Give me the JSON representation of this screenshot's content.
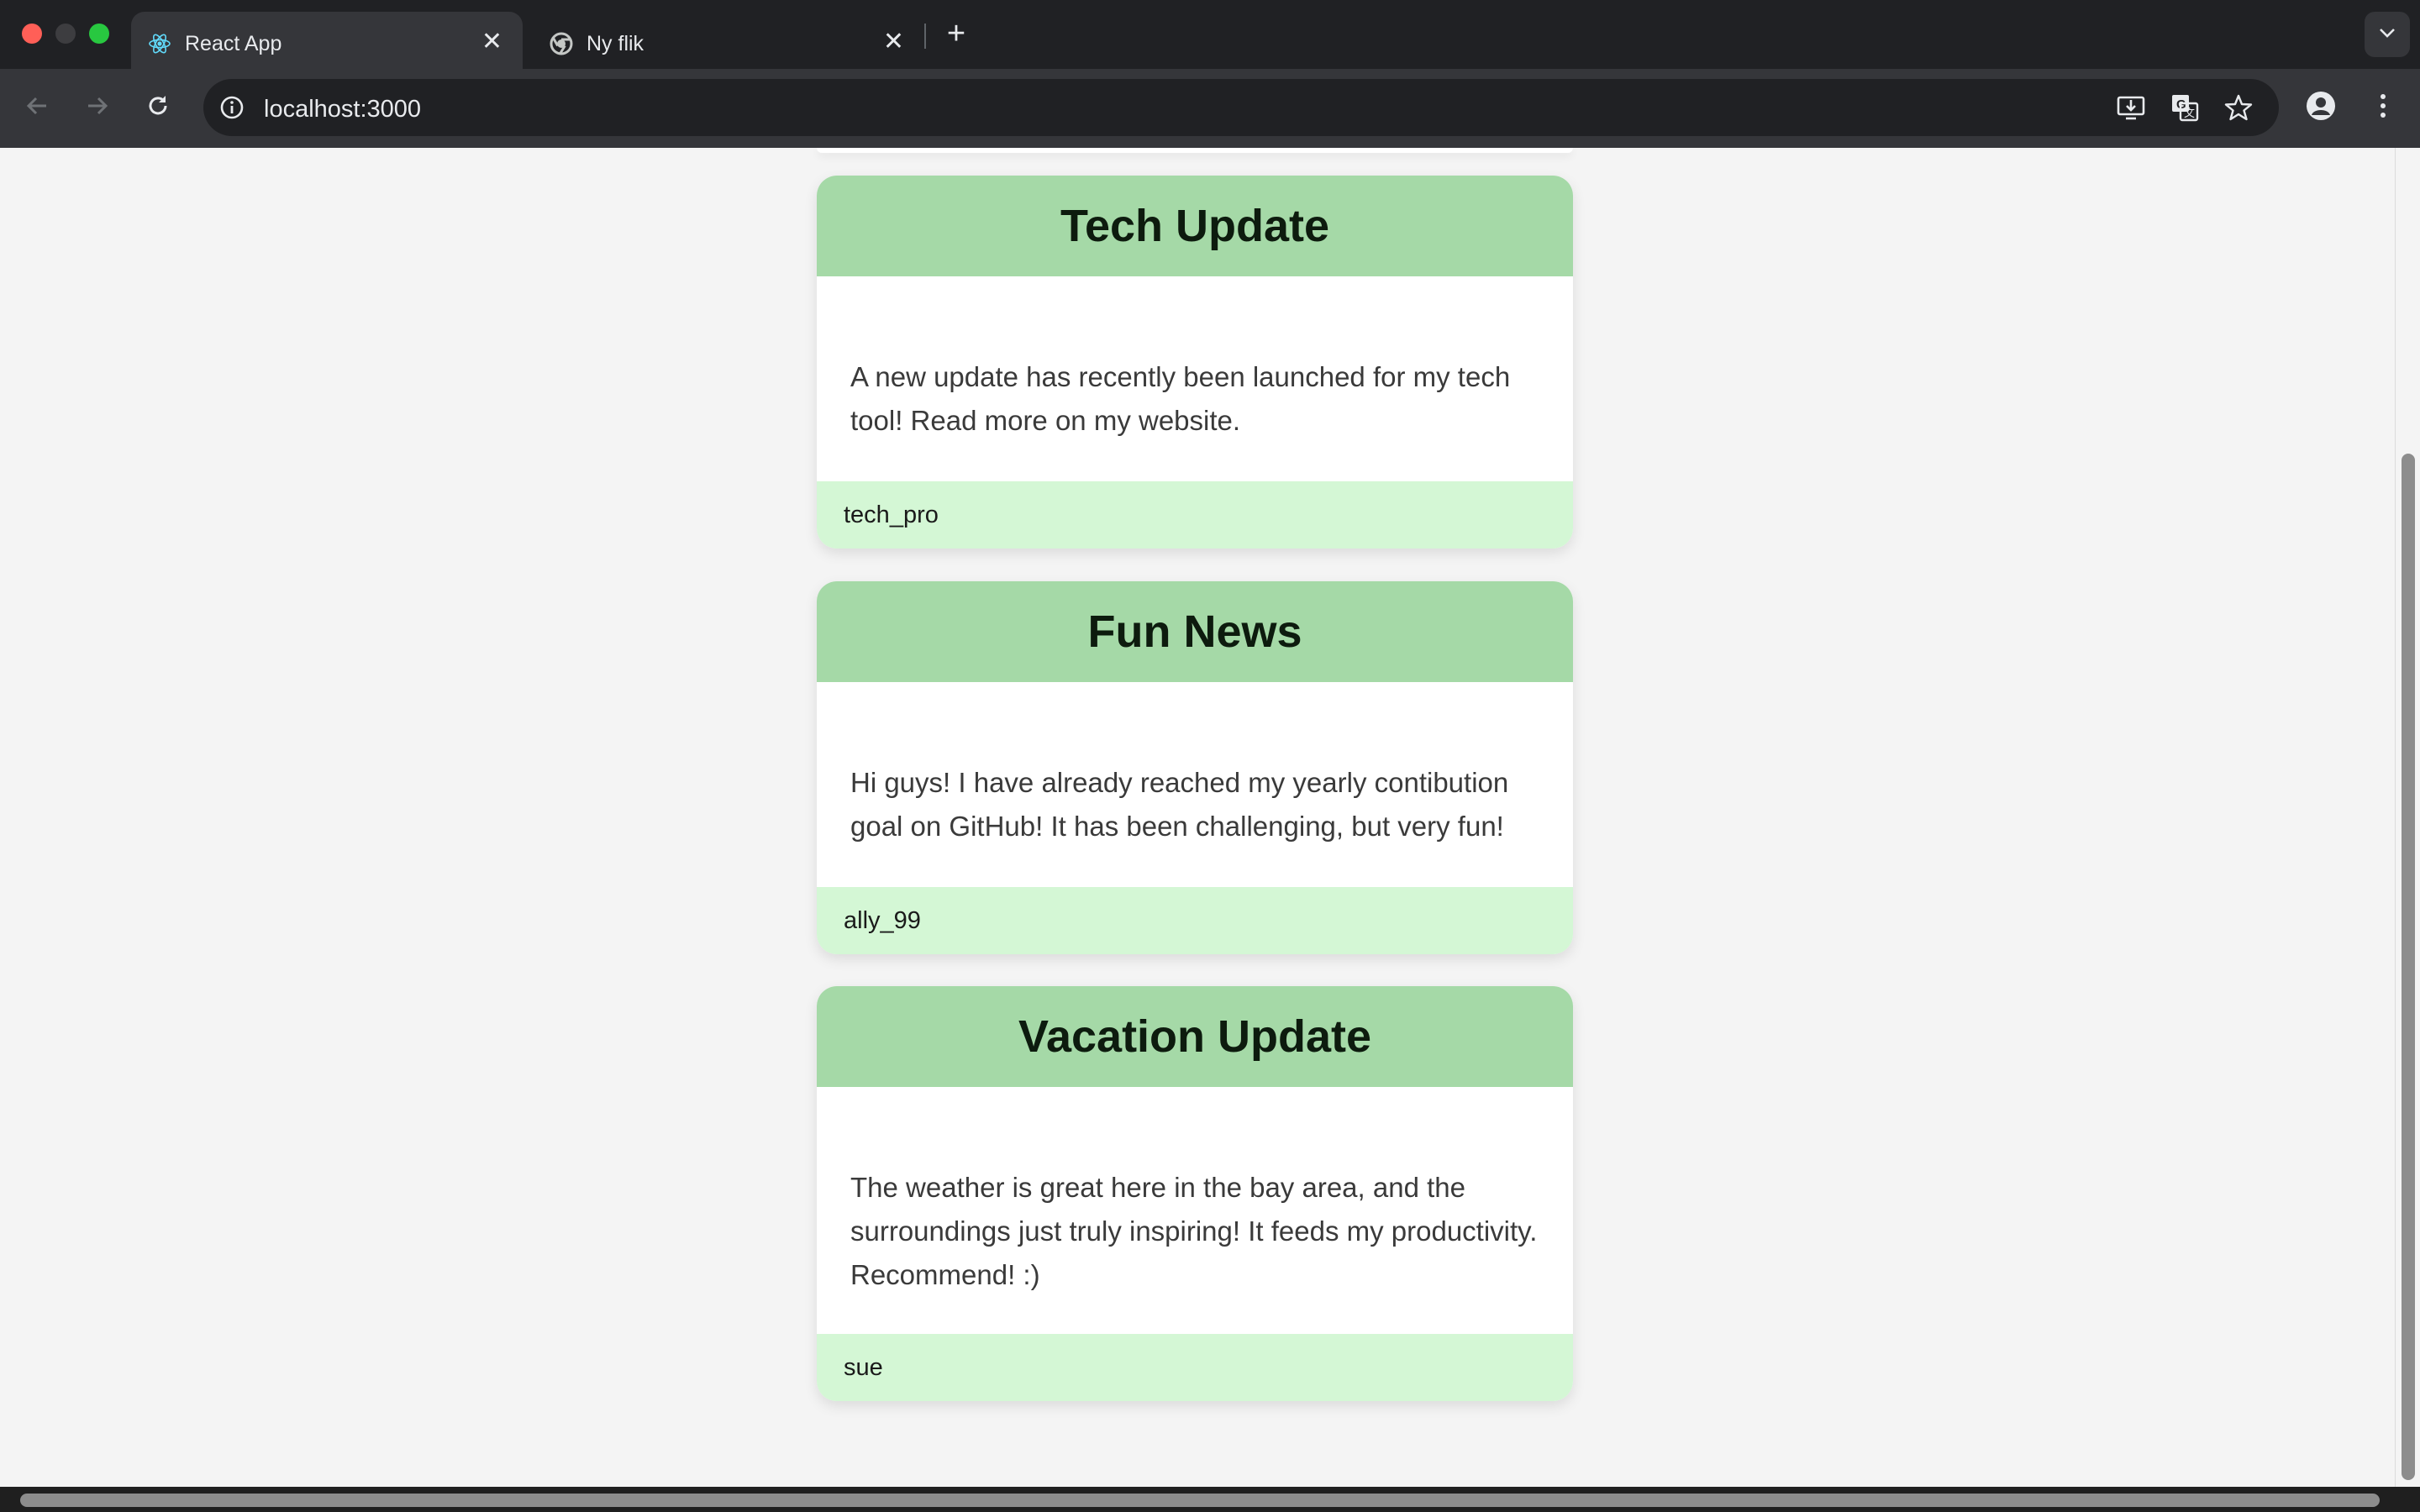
{
  "browser": {
    "tabs": [
      {
        "title": "React App",
        "active": true,
        "favicon": "react-icon"
      },
      {
        "title": "Ny flik",
        "active": false,
        "favicon": "chrome-icon"
      }
    ],
    "new_tab_label": "+",
    "close_label": "✕",
    "url": "localhost:3000"
  },
  "posts": [
    {
      "title": "Tech Update",
      "body": "A new update has recently been launched for my tech tool! Read more on my website.",
      "author": "tech_pro"
    },
    {
      "title": "Fun News",
      "body": "Hi guys! I have already reached my yearly contibution goal on GitHub! It has been challenging, but very fun!",
      "author": "ally_99"
    },
    {
      "title": "Vacation Update",
      "body": "The weather is great here in the bay area, and the surroundings just truly inspiring! It feeds my productivity. Recommend! :)",
      "author": "sue"
    }
  ],
  "colors": {
    "card_header": "#a5d9a7",
    "card_footer": "#d4f7d5",
    "page_background": "#f4f4f4",
    "chrome_dark": "#202124",
    "chrome_toolbar": "#35363a"
  }
}
